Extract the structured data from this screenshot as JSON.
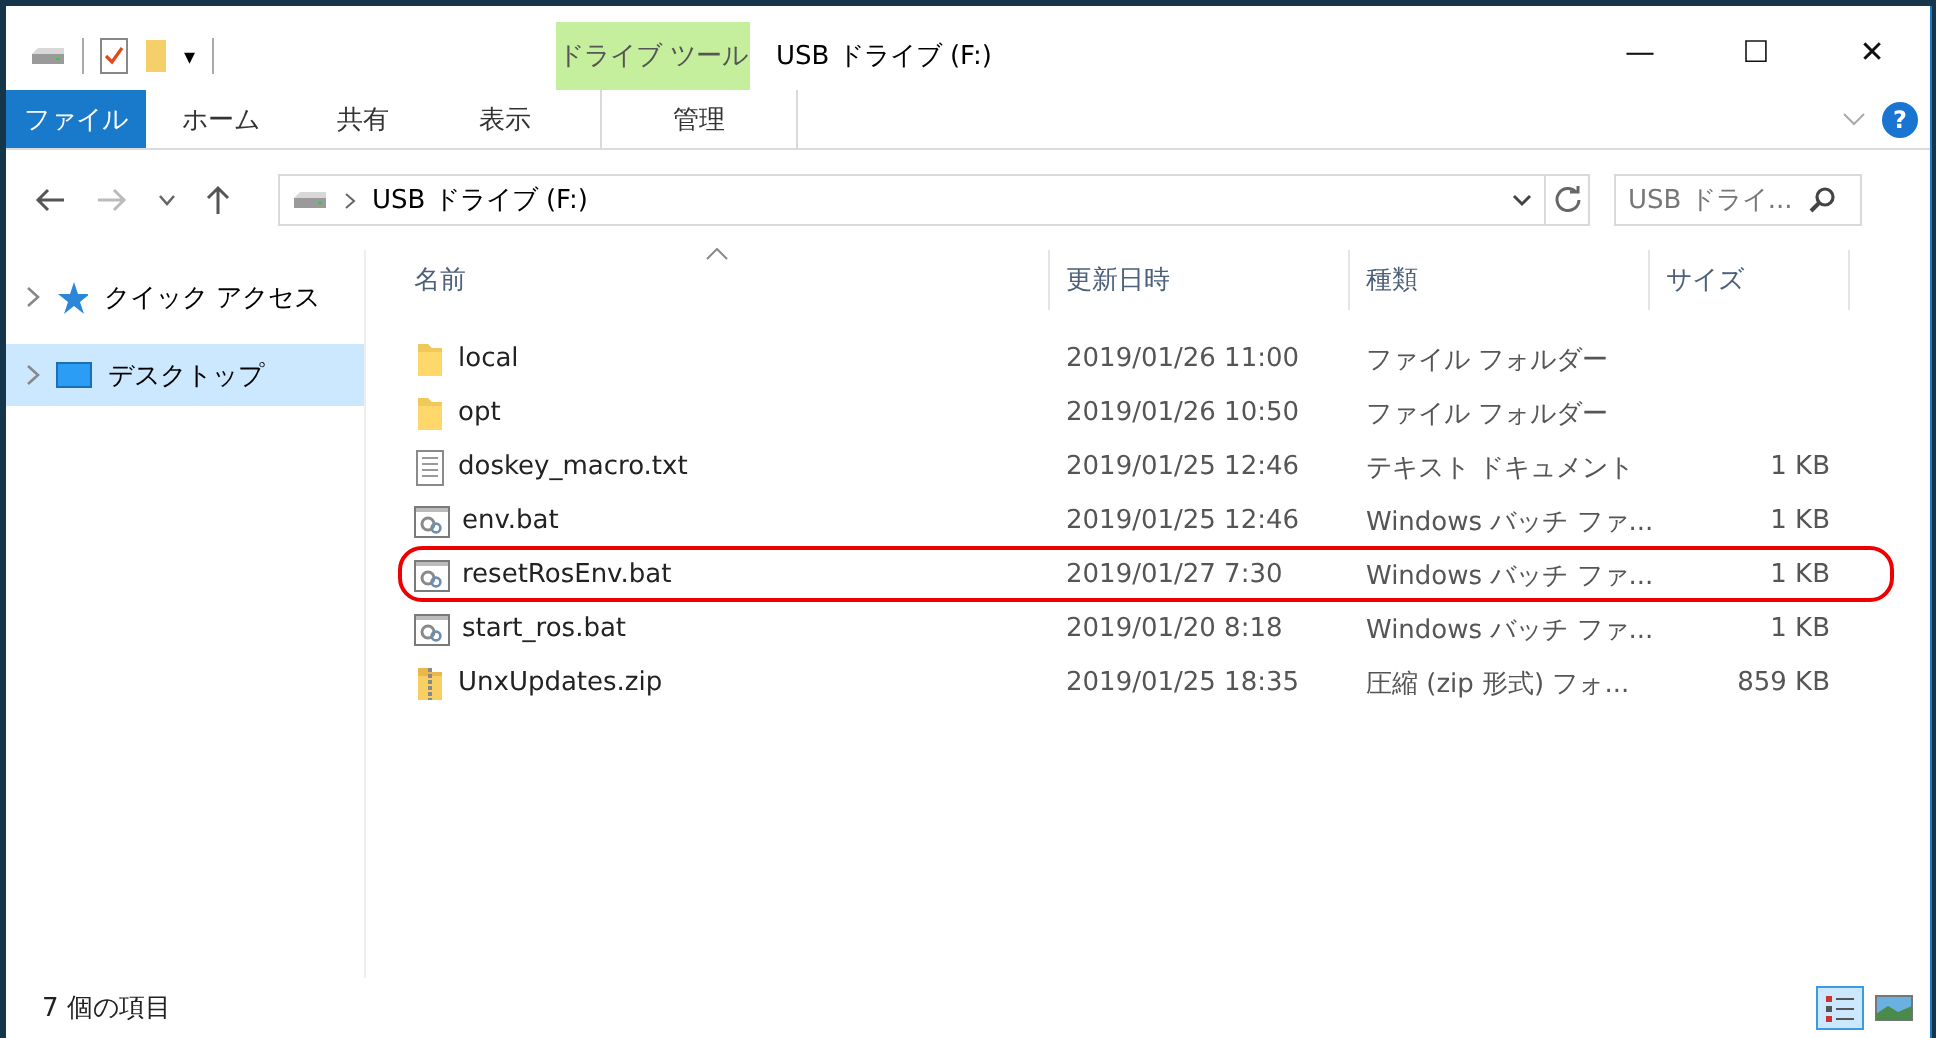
{
  "quick_access_toolbar": {
    "customize": "▾"
  },
  "window": {
    "title": "USB ドライブ (F:)",
    "context_tab": "ドライブ ツール",
    "controls": {
      "minimize": "—",
      "maximize": "☐",
      "close": "✕"
    }
  },
  "ribbon": {
    "tabs": [
      {
        "label": "ファイル",
        "kind": "file",
        "selected": false
      },
      {
        "label": "ホーム",
        "kind": "normal",
        "selected": false
      },
      {
        "label": "共有",
        "kind": "normal",
        "selected": false
      },
      {
        "label": "表示",
        "kind": "normal",
        "selected": false
      },
      {
        "label": "管理",
        "kind": "context",
        "selected": false
      }
    ],
    "help": "?"
  },
  "address_bar": {
    "path": "USB ドライブ (F:)",
    "search_placeholder": "USB ドライ..."
  },
  "navigation_pane": {
    "items": [
      {
        "label": "クイック アクセス",
        "kind": "quick",
        "selected": false
      },
      {
        "label": "デスクトップ",
        "kind": "desktop",
        "selected": true
      }
    ]
  },
  "file_list": {
    "columns": [
      {
        "label": "名前",
        "sorted": true
      },
      {
        "label": "更新日時",
        "sorted": false
      },
      {
        "label": "種類",
        "sorted": false
      },
      {
        "label": "サイズ",
        "sorted": false
      }
    ],
    "rows": [
      {
        "name": "local",
        "modified": "2019/01/26 11:00",
        "type": "ファイル フォルダー",
        "size": "",
        "kind": "folder",
        "highlighted": false
      },
      {
        "name": "opt",
        "modified": "2019/01/26 10:50",
        "type": "ファイル フォルダー",
        "size": "",
        "kind": "folder",
        "highlighted": false
      },
      {
        "name": "doskey_macro.txt",
        "modified": "2019/01/25 12:46",
        "type": "テキスト ドキュメント",
        "size": "1 KB",
        "kind": "text",
        "highlighted": false
      },
      {
        "name": "env.bat",
        "modified": "2019/01/25 12:46",
        "type": "Windows バッチ ファ...",
        "size": "1 KB",
        "kind": "batch",
        "highlighted": false
      },
      {
        "name": "resetRosEnv.bat",
        "modified": "2019/01/27 7:30",
        "type": "Windows バッチ ファ...",
        "size": "1 KB",
        "kind": "batch",
        "highlighted": true
      },
      {
        "name": "start_ros.bat",
        "modified": "2019/01/20 8:18",
        "type": "Windows バッチ ファ...",
        "size": "1 KB",
        "kind": "batch",
        "highlighted": false
      },
      {
        "name": "UnxUpdates.zip",
        "modified": "2019/01/25 18:35",
        "type": "圧縮 (zip 形式) フォ...",
        "size": "859 KB",
        "kind": "zip",
        "highlighted": false
      }
    ]
  },
  "status_bar": {
    "item_count": "7 個の項目",
    "views": [
      {
        "kind": "details",
        "selected": true
      },
      {
        "kind": "thumbnails",
        "selected": false
      }
    ]
  }
}
